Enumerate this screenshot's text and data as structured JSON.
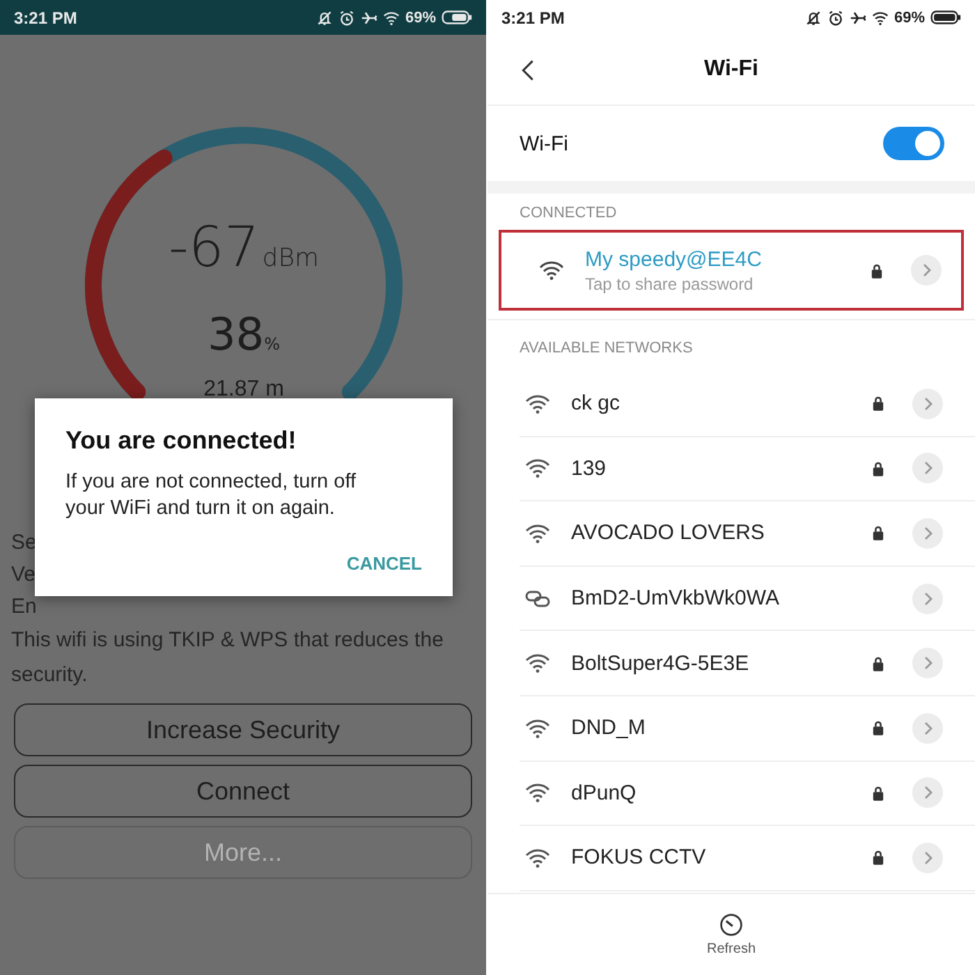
{
  "left_screen": {
    "status_bar": {
      "time": "3:21 PM",
      "battery": "69%"
    },
    "gauge": {
      "signal": "-67",
      "signal_unit": "dBm",
      "percent": "38",
      "percent_unit": "%",
      "distance": "21.87 m"
    },
    "detail_fragments": [
      "Se",
      "Ve",
      "En"
    ],
    "warning": "This wifi is using TKIP & WPS that reduces the security.",
    "buttons": [
      {
        "label": "Increase Security",
        "disabled": false
      },
      {
        "label": "Connect",
        "disabled": false
      },
      {
        "label": "More...",
        "disabled": true
      }
    ],
    "dialog": {
      "title": "You are connected!",
      "message": "If you are not connected, turn off your WiFi and turn it on again.",
      "action": "CANCEL"
    }
  },
  "right_screen": {
    "status_bar": {
      "time": "3:21 PM",
      "battery": "69%"
    },
    "title": "Wi-Fi",
    "wifi_toggle": {
      "label": "Wi-Fi",
      "on": true
    },
    "connected_header": "CONNECTED",
    "connected": {
      "name": "My speedy@EE4C",
      "subtitle": "Tap to share password",
      "locked": true,
      "outlined": true
    },
    "available_header": "AVAILABLE NETWORKS",
    "networks": [
      {
        "name": "ck gc",
        "kind": "wifi",
        "locked": true
      },
      {
        "name": "139",
        "kind": "wifi",
        "locked": true
      },
      {
        "name": "AVOCADO LOVERS",
        "kind": "wifi",
        "locked": true
      },
      {
        "name": "BmD2-UmVkbWk0WA",
        "kind": "link",
        "locked": false
      },
      {
        "name": "BoltSuper4G-5E3E",
        "kind": "wifi",
        "locked": true
      },
      {
        "name": "DND_M",
        "kind": "wifi",
        "locked": true
      },
      {
        "name": "dPunQ",
        "kind": "wifi",
        "locked": true
      },
      {
        "name": "FOKUS CCTV",
        "kind": "wifi",
        "locked": true
      }
    ],
    "bottom_action": "Refresh"
  }
}
